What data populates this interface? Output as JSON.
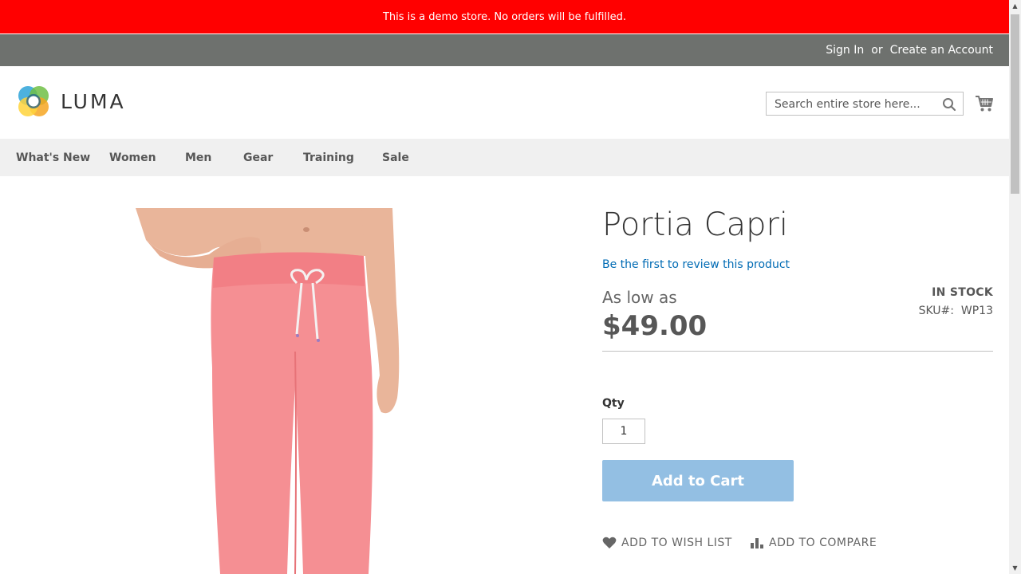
{
  "banner": {
    "text": "This is a demo store. No orders will be fulfilled."
  },
  "top_links": {
    "sign_in": "Sign In",
    "or": "or",
    "create_account": "Create an Account"
  },
  "logo": {
    "text": "LUMA"
  },
  "search": {
    "placeholder": "Search entire store here...",
    "icon": "search-icon"
  },
  "cart": {
    "icon": "cart-icon"
  },
  "nav": {
    "items": [
      "What's New",
      "Women",
      "Men",
      "Gear",
      "Training",
      "Sale"
    ]
  },
  "product": {
    "title": "Portia Capri",
    "review_link": "Be the first to review this product",
    "as_low_as": "As low as",
    "price": "$49.00",
    "stock": "IN STOCK",
    "sku_label": "SKU#:",
    "sku_value": "WP13",
    "qty_label": "Qty",
    "qty_value": "1",
    "add_to_cart": "Add to Cart",
    "wish_list": "Add to Wish List",
    "compare": "Add to Compare"
  },
  "colors": {
    "banner": "#ff0000",
    "top_bar": "#6e716e",
    "nav_bg": "#f0f0f0",
    "link": "#006bb4",
    "cart_button": "#93bfe3",
    "product_color": "#f58f93"
  }
}
